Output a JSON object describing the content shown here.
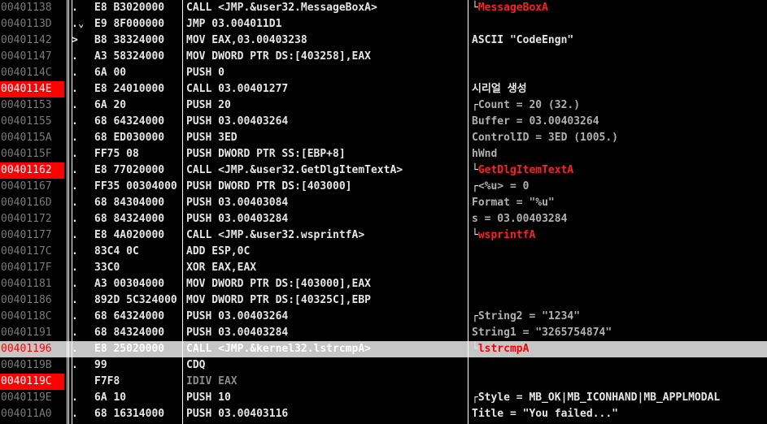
{
  "rows": [
    {
      "addr": "00401138",
      "mark": ".",
      "bytes": "E8 B3020000",
      "instr": "CALL <JMP.&user32.MessageBoxA>",
      "comment_bracket": "└",
      "comment": "MessageBoxA",
      "comment_style": "api"
    },
    {
      "addr": "0040113D",
      "mark": ".⌄",
      "bytes": "E9 8F000000",
      "instr": "JMP 03.004011D1",
      "comment_bracket": "",
      "comment": "",
      "comment_style": ""
    },
    {
      "addr": "00401142",
      "mark": ">",
      "bytes": "B8 38324000",
      "instr": "MOV EAX,03.00403238",
      "comment_bracket": "",
      "comment": "ASCII \"CodeEngn\"",
      "comment_style": ""
    },
    {
      "addr": "00401147",
      "mark": ".",
      "bytes": "A3 58324000",
      "instr": "MOV DWORD PTR DS:[403258],EAX",
      "comment_bracket": "",
      "comment": "",
      "comment_style": ""
    },
    {
      "addr": "0040114C",
      "mark": ".",
      "bytes": "6A 00",
      "instr": "PUSH 0",
      "comment_bracket": "",
      "comment": "",
      "comment_style": ""
    },
    {
      "addr": "0040114E",
      "mark": ".",
      "bytes": "E8 24010000",
      "instr": "CALL 03.00401277",
      "comment_bracket": "",
      "comment": "시리얼 생성",
      "comment_style": "",
      "bp": true
    },
    {
      "addr": "00401153",
      "mark": ".",
      "bytes": "6A 20",
      "instr": "PUSH 20",
      "comment_bracket": "┌",
      "comment": "Count = 20 (32.)",
      "comment_style": "dim"
    },
    {
      "addr": "00401155",
      "mark": ".",
      "bytes": "68 64324000",
      "instr": "PUSH 03.00403264",
      "comment_bracket": "",
      "comment": "Buffer = 03.00403264",
      "comment_style": "dim"
    },
    {
      "addr": "0040115A",
      "mark": ".",
      "bytes": "68 ED030000",
      "instr": "PUSH 3ED",
      "comment_bracket": "",
      "comment": "ControlID = 3ED (1005.)",
      "comment_style": "dim"
    },
    {
      "addr": "0040115F",
      "mark": ".",
      "bytes": "FF75 08",
      "instr": "PUSH DWORD PTR SS:[EBP+8]",
      "comment_bracket": "",
      "comment": "hWnd",
      "comment_style": "dim"
    },
    {
      "addr": "00401162",
      "mark": ".",
      "bytes": "E8 77020000",
      "instr": "CALL <JMP.&user32.GetDlgItemTextA>",
      "comment_bracket": "└",
      "comment": "GetDlgItemTextA",
      "comment_style": "api",
      "bp": true
    },
    {
      "addr": "00401167",
      "mark": ".",
      "bytes": "FF35 00304000",
      "instr": "PUSH DWORD PTR DS:[403000]",
      "comment_bracket": "┌",
      "comment": "<%u> = 0",
      "comment_style": "dim"
    },
    {
      "addr": "0040116D",
      "mark": ".",
      "bytes": "68 84304000",
      "instr": "PUSH 03.00403084",
      "comment_bracket": "",
      "comment": "Format = \"%u\"",
      "comment_style": "dim"
    },
    {
      "addr": "00401172",
      "mark": ".",
      "bytes": "68 84324000",
      "instr": "PUSH 03.00403284",
      "comment_bracket": "",
      "comment": "s = 03.00403284",
      "comment_style": "dim"
    },
    {
      "addr": "00401177",
      "mark": ".",
      "bytes": "E8 4A020000",
      "instr": "CALL <JMP.&user32.wsprintfA>",
      "comment_bracket": "└",
      "comment": "wsprintfA",
      "comment_style": "api"
    },
    {
      "addr": "0040117C",
      "mark": ".",
      "bytes": "83C4 0C",
      "instr": "ADD ESP,0C",
      "comment_bracket": "",
      "comment": "",
      "comment_style": ""
    },
    {
      "addr": "0040117F",
      "mark": ".",
      "bytes": "33C0",
      "instr": "XOR EAX,EAX",
      "comment_bracket": "",
      "comment": "",
      "comment_style": ""
    },
    {
      "addr": "00401181",
      "mark": ".",
      "bytes": "A3 00304000",
      "instr": "MOV DWORD PTR DS:[403000],EAX",
      "comment_bracket": "",
      "comment": "",
      "comment_style": ""
    },
    {
      "addr": "00401186",
      "mark": ".",
      "bytes": "892D 5C324000",
      "instr": "MOV DWORD PTR DS:[40325C],EBP",
      "comment_bracket": "",
      "comment": "",
      "comment_style": ""
    },
    {
      "addr": "0040118C",
      "mark": ".",
      "bytes": "68 64324000",
      "instr": "PUSH 03.00403264",
      "comment_bracket": "┌",
      "comment": "String2 = \"1234\"",
      "comment_style": "dim"
    },
    {
      "addr": "00401191",
      "mark": ".",
      "bytes": "68 84324000",
      "instr": "PUSH 03.00403284",
      "comment_bracket": "",
      "comment": "String1 = \"3265754874\"",
      "comment_style": "dim"
    },
    {
      "addr": "00401196",
      "mark": ".",
      "bytes": "E8 25020000",
      "instr": "CALL <JMP.&kernel32.lstrcmpA>",
      "comment_bracket": "└",
      "comment": "lstrcmpA",
      "comment_style": "api",
      "selected": true
    },
    {
      "addr": "0040119B",
      "mark": ".",
      "bytes": "99",
      "instr": "CDQ",
      "comment_bracket": "",
      "comment": "",
      "comment_style": ""
    },
    {
      "addr": "0040119C",
      "mark": "",
      "bytes": "F7F8",
      "instr": "IDIV EAX",
      "comment_bracket": "",
      "comment": "",
      "comment_style": "",
      "bp": true,
      "instr_dim": true
    },
    {
      "addr": "0040119E",
      "mark": ".",
      "bytes": "6A 10",
      "instr": "PUSH 10",
      "comment_bracket": "┌",
      "comment": "Style = MB_OK|MB_ICONHAND|MB_APPLMODAL",
      "comment_style": ""
    },
    {
      "addr": "004011A0",
      "mark": ".",
      "bytes": "68 16314000",
      "instr": "PUSH 03.00403116",
      "comment_bracket": "",
      "comment": "Title = \"You failed...\"",
      "comment_style": ""
    }
  ]
}
